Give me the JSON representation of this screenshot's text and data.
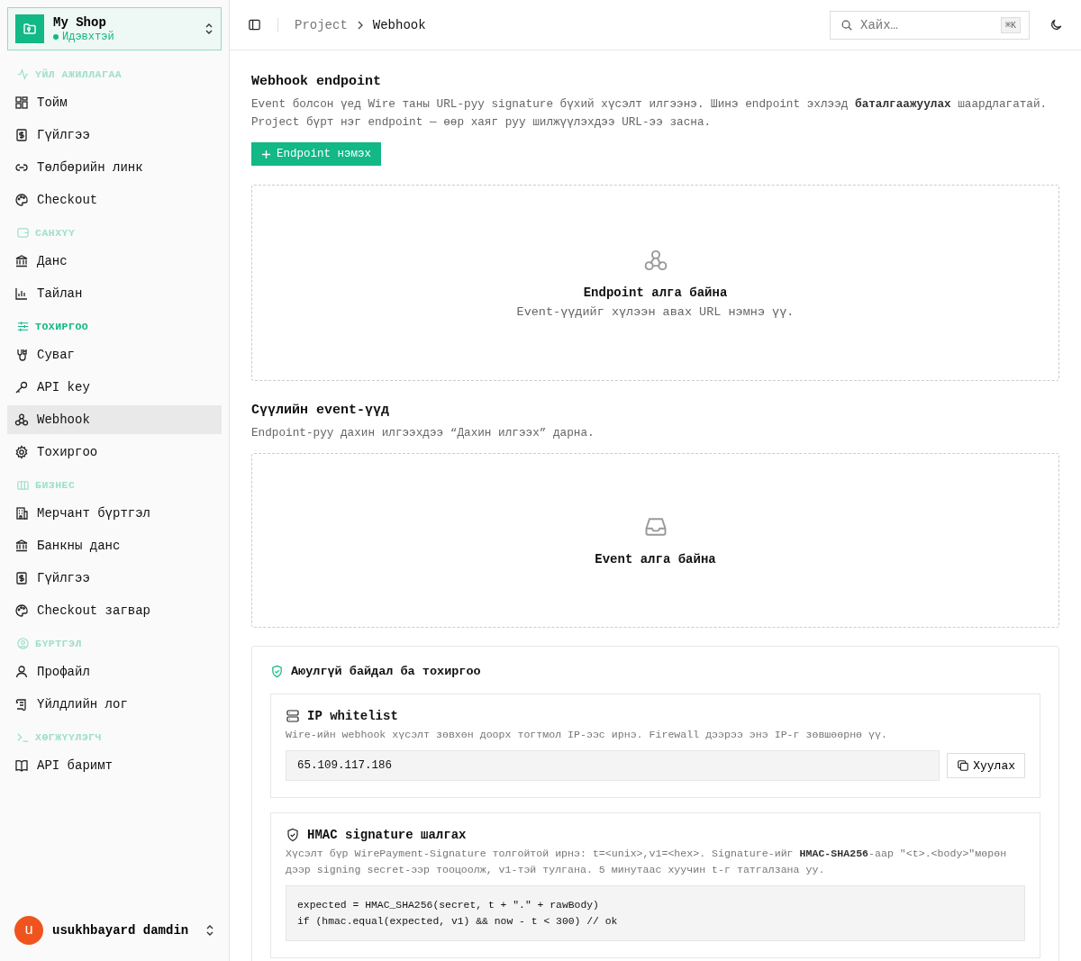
{
  "workspace": {
    "name": "My Shop",
    "status": "Идэвхтэй"
  },
  "sidebar": {
    "sections": [
      {
        "label": "ҮЙЛ АЖИЛЛАГАА",
        "active": false,
        "items": [
          {
            "label": "Тойм",
            "selected": false
          },
          {
            "label": "Гүйлгээ",
            "selected": false
          },
          {
            "label": "Төлбөрийн линк",
            "selected": false
          },
          {
            "label": "Checkout",
            "selected": false
          }
        ]
      },
      {
        "label": "САНХҮҮ",
        "active": false,
        "items": [
          {
            "label": "Данс",
            "selected": false
          },
          {
            "label": "Тайлан",
            "selected": false
          }
        ]
      },
      {
        "label": "ТОХИРГОО",
        "active": true,
        "items": [
          {
            "label": "Суваг",
            "selected": false
          },
          {
            "label": "API key",
            "selected": false
          },
          {
            "label": "Webhook",
            "selected": true
          },
          {
            "label": "Тохиргоо",
            "selected": false
          }
        ]
      },
      {
        "label": "БИЗНЕС",
        "active": false,
        "items": [
          {
            "label": "Мерчант бүртгэл",
            "selected": false
          },
          {
            "label": "Банкны данс",
            "selected": false
          },
          {
            "label": "Гүйлгээ",
            "selected": false
          },
          {
            "label": "Checkout загвар",
            "selected": false
          }
        ]
      },
      {
        "label": "БҮРТГЭЛ",
        "active": false,
        "items": [
          {
            "label": "Профайл",
            "selected": false
          },
          {
            "label": "Үйлдлийн лог",
            "selected": false
          }
        ]
      },
      {
        "label": "ХӨГЖҮҮЛЭГЧ",
        "active": false,
        "items": [
          {
            "label": "API баримт",
            "selected": false
          }
        ]
      }
    ]
  },
  "user": {
    "initial": "u",
    "name": "usukhbayard damdin"
  },
  "breadcrumb": [
    "Project",
    "Webhook"
  ],
  "search": {
    "placeholder": "Хайх…",
    "shortcut": "⌘K"
  },
  "endpoint_section": {
    "title": "Webhook endpoint",
    "description": "Event болсон үед Wire таны URL-руу signature бүхий хүсэлт илгээнэ. Шинэ endpoint эхлээд **баталгаажуулах** шаардлагатай. Project бүрт нэг endpoint — өөр хаяг руу шилжүүлэхдээ URL-ээ засна.",
    "add_button": "Endpoint нэмэх",
    "empty_title": "Endpoint алга байна",
    "empty_text": "Event-үүдийг хүлээн авах URL нэмнэ үү."
  },
  "events_section": {
    "title": "Сүүлийн event-үүд",
    "description": "Endpoint-руу дахин илгээхдээ “Дахин илгээх” дарна.",
    "empty_title": "Event алга байна"
  },
  "security": {
    "title": "Аюулгүй байдал ба тохиргоо",
    "ip": {
      "title": "IP whitelist",
      "description": "Wire-ийн webhook хүсэлт зөвхөн доорх тогтмол IP-ээс ирнэ. Firewall дээрээ энэ IP-г зөвшөөрнө үү.",
      "value": "65.109.117.186",
      "copy_button": "Хуулах"
    },
    "hmac": {
      "title": "HMAC signature шалгах",
      "description": "Хүсэлт бүр WirePayment-Signature толгойтой ирнэ: t=<unix>,v1=<hex>. Signature-ийг **HMAC-SHA256**-аар \"<t>.<body>\"мөрөн дээр signing secret-ээр тооцоолж, v1-тэй тулгана. 5 минутаас хуучин t-г татгалзана уу.",
      "code": [
        "expected = HMAC_SHA256(secret, t + \".\" + rawBody)",
        "if (hmac.equal(expected, v1) && now - t < 300) // ok"
      ]
    }
  }
}
